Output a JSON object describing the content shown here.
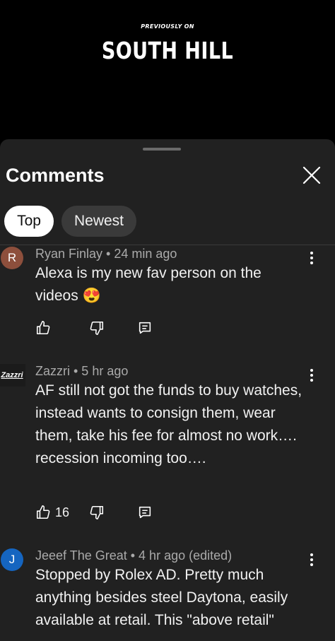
{
  "video": {
    "kicker": "PREVIOUSLY ON",
    "title": "SOUTH HILL"
  },
  "sheet": {
    "title": "Comments",
    "close_icon": "close-icon"
  },
  "filters": [
    {
      "label": "Top",
      "selected": true
    },
    {
      "label": "Newest",
      "selected": false
    }
  ],
  "comments": [
    {
      "avatar_letter": "R",
      "avatar_color": "#8d4f3c",
      "meta": "Ryan Finlay • 24 min ago",
      "text": "Alexa is my new fav person on the videos 😍",
      "likes": ""
    },
    {
      "avatar_letter": "Zazzri",
      "avatar_color": "#1b1b1b",
      "meta": "Zazzri  • 5 hr ago",
      "text": "AF still not got the funds to buy watches, instead wants to consign them, wear them, take his fee for almost no work…. recession incoming too….",
      "likes": "16"
    },
    {
      "avatar_letter": "J",
      "avatar_color": "#1565c0",
      "meta": "Jeeef The Great • 4 hr ago (edited)",
      "text": "Stopped by Rolex AD.   Pretty much anything besides steel Daytona, easily available at retail.  This \"above retail\"",
      "likes": ""
    }
  ],
  "icons": {
    "like": "thumbs-up-icon",
    "dislike": "thumbs-down-icon",
    "reply": "reply-icon",
    "more": "more-vertical-icon"
  },
  "colors": {
    "sheet_bg": "#212121",
    "chip_selected_bg": "#ffffff",
    "chip_bg": "#3a3a3a",
    "meta_text": "#aaaaaa"
  }
}
